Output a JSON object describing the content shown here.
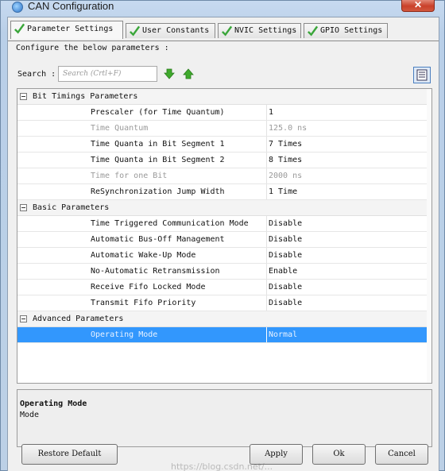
{
  "window": {
    "title": "CAN Configuration",
    "close_label": "✕"
  },
  "tabs": [
    {
      "label": "Parameter Settings",
      "active": true
    },
    {
      "label": "User Constants",
      "active": false
    },
    {
      "label": "NVIC Settings",
      "active": false
    },
    {
      "label": "GPIO Settings",
      "active": false
    }
  ],
  "configure_text": "Configure the below parameters :",
  "search": {
    "label": "Search :",
    "placeholder": "Search (Crtl+F)"
  },
  "groups": [
    {
      "label": "Bit Timings Parameters",
      "rows": [
        {
          "name": "Prescaler (for Time Quantum)",
          "value": "1",
          "disabled": false
        },
        {
          "name": "Time Quantum",
          "value": "125.0 ns",
          "disabled": true
        },
        {
          "name": "Time Quanta in Bit Segment 1",
          "value": "7 Times",
          "disabled": false
        },
        {
          "name": "Time Quanta in Bit Segment 2",
          "value": "8 Times",
          "disabled": false
        },
        {
          "name": "Time for one Bit",
          "value": "2000 ns",
          "disabled": true
        },
        {
          "name": "ReSynchronization Jump Width",
          "value": "1 Time",
          "disabled": false
        }
      ]
    },
    {
      "label": "Basic Parameters",
      "rows": [
        {
          "name": "Time Triggered Communication Mode",
          "value": "Disable",
          "disabled": false
        },
        {
          "name": "Automatic Bus-Off Management",
          "value": "Disable",
          "disabled": false
        },
        {
          "name": "Automatic Wake-Up Mode",
          "value": "Disable",
          "disabled": false
        },
        {
          "name": "No-Automatic Retransmission",
          "value": "Enable",
          "disabled": false
        },
        {
          "name": "Receive Fifo Locked Mode",
          "value": "Disable",
          "disabled": false
        },
        {
          "name": "Transmit Fifo Priority",
          "value": "Disable",
          "disabled": false
        }
      ]
    },
    {
      "label": "Advanced Parameters",
      "rows": [
        {
          "name": "Operating Mode",
          "value": "Normal",
          "disabled": false,
          "selected": true
        }
      ]
    }
  ],
  "description": {
    "title": "Operating Mode",
    "text": "Mode"
  },
  "buttons": {
    "restore": "Restore Default",
    "apply": "Apply",
    "ok": "Ok",
    "cancel": "Cancel"
  },
  "watermark": "https://blog.csdn.net/...",
  "colors": {
    "selection": "#3297fd",
    "check": "#3aa63a",
    "close": "#c9402a"
  }
}
